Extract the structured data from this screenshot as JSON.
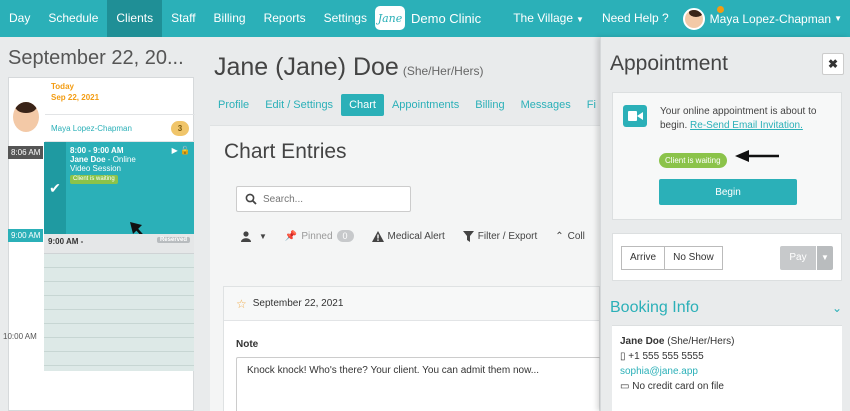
{
  "topnav": {
    "items": [
      "Day",
      "Schedule",
      "Clients",
      "Staff",
      "Billing",
      "Reports",
      "Settings"
    ],
    "active_index": 2,
    "brand_logo": "Jane",
    "brand_name": "Demo Clinic",
    "location": "The Village",
    "help": "Need Help ?",
    "user_name": "Maya Lopez-Chapman"
  },
  "calendar": {
    "date_heading": "September 22, 20...",
    "today_label": "Today",
    "today_date": "Sep 22, 2021",
    "provider": "Maya Lopez-Chapman",
    "provider_count": "3",
    "time_806": "8:06 AM",
    "time_900": "9:00 AM",
    "time_1000": "10:00 AM",
    "appointment": {
      "time": "8:00 - 9:00 AM",
      "client": "Jane Doe",
      "type_suffix": " - Online",
      "type_line2": "Video Session",
      "status": "Client is waiting"
    },
    "reserved_time": "9:00 AM -",
    "reserved_label": "Reserved"
  },
  "patient": {
    "name": "Jane (Jane) Doe",
    "pronouns": "(She/Her/Hers)"
  },
  "tabs": [
    "Profile",
    "Edit / Settings",
    "Chart",
    "Appointments",
    "Billing",
    "Messages",
    "Fi"
  ],
  "tabs_active_index": 2,
  "chart": {
    "title": "Chart Entries",
    "search_placeholder": "Search...",
    "pinned_label": "Pinned",
    "pinned_count": "0",
    "medical_alert": "Medical Alert",
    "filter_export": "Filter / Export",
    "collapse": "Coll",
    "entry_date": "September 22, 2021",
    "note_label": "Note",
    "note_text": "Knock knock! Who's there? Your client. You can admit them now..."
  },
  "appointment_panel": {
    "title": "Appointment",
    "close": "✖",
    "message": "Your online appointment is about to begin.",
    "resend_link": "Re-Send Email Invitation.",
    "waiting_badge": "Client is waiting",
    "begin_label": "Begin",
    "arrive_label": "Arrive",
    "no_show_label": "No Show",
    "pay_label": "Pay"
  },
  "booking": {
    "title": "Booking Info",
    "client_name": "Jane Doe",
    "client_pronouns": "(She/Her/Hers)",
    "phone": "+1 555 555 5555",
    "email": "sophia@jane.app",
    "card": "No credit card on file"
  }
}
